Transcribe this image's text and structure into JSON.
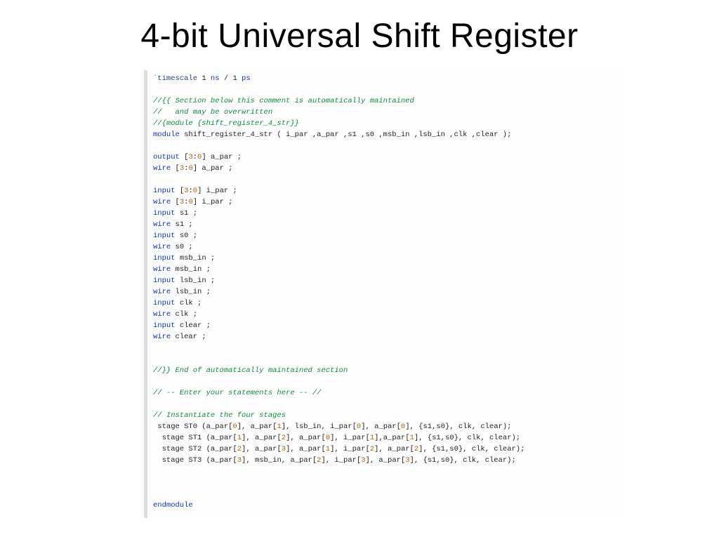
{
  "title": "4-bit Universal Shift Register",
  "code": {
    "timescale": {
      "kw": "`timescale",
      "val": " 1 ",
      "unit1": "ns",
      "slash": " / ",
      "one2": "1 ",
      "unit2": "ps"
    },
    "c1": "//{{ Section below this comment is automatically maintained",
    "c2": "//   and may be overwritten",
    "c3": "//{module {shift_register_4_str}}",
    "mod": {
      "kw": "module",
      "name": " shift_register_4_str ( i_par ,a_par ,s1 ,s0 ,msb_in ,lsb_in ,clk ,clear );"
    },
    "d01": {
      "kw": "output",
      "rng1": " [",
      "n1": "3",
      "colon": ":",
      "n2": "0",
      "rng2": "] ",
      "sig": "a_par ;"
    },
    "d02": {
      "kw": "wire",
      "rng1": " [",
      "n1": "3",
      "colon": ":",
      "n2": "0",
      "rng2": "] ",
      "sig": "a_par ;"
    },
    "d03": {
      "kw": "input",
      "rng1": " [",
      "n1": "3",
      "colon": ":",
      "n2": "0",
      "rng2": "] ",
      "sig": "i_par ;"
    },
    "d04": {
      "kw": "wire",
      "rng1": " [",
      "n1": "3",
      "colon": ":",
      "n2": "0",
      "rng2": "] ",
      "sig": "i_par ;"
    },
    "d05": {
      "kw": "input",
      "sig": " s1 ;"
    },
    "d06": {
      "kw": "wire",
      "sig": " s1 ;"
    },
    "d07": {
      "kw": "input",
      "sig": " s0 ;"
    },
    "d08": {
      "kw": "wire",
      "sig": " s0 ;"
    },
    "d09": {
      "kw": "input",
      "sig": " msb_in ;"
    },
    "d10": {
      "kw": "wire",
      "sig": " msb_in ;"
    },
    "d11": {
      "kw": "input",
      "sig": " lsb_in ;"
    },
    "d12": {
      "kw": "wire",
      "sig": " lsb_in ;"
    },
    "d13": {
      "kw": "input",
      "sig": " clk ;"
    },
    "d14": {
      "kw": "wire",
      "sig": " clk ;"
    },
    "d15": {
      "kw": "input",
      "sig": " clear ;"
    },
    "d16": {
      "kw": "wire",
      "sig": " clear ;"
    },
    "c4": "//}} End of automatically maintained section",
    "c5": "// -- Enter your statements here -- //",
    "c6": "// Instantiate the four stages",
    "s0a": " stage ST0 (a_par[",
    "s0n1": "0",
    "s0b": "], a_par[",
    "s0n2": "1",
    "s0c": "], lsb_in, i_par[",
    "s0n3": "0",
    "s0d": "], a_par[",
    "s0n4": "0",
    "s0e": "], {s1,s0}, clk, clear);",
    "s1a": "  stage ST1 (a_par[",
    "s1n1": "1",
    "s1b": "], a_par[",
    "s1n2": "2",
    "s1c": "], a_par[",
    "s1n3": "0",
    "s1d": "], i_par[",
    "s1n4": "1",
    "s1e": "],a_par[",
    "s1n5": "1",
    "s1f": "], {s1,s0}, clk, clear);",
    "s2a": "  stage ST2 (a_par[",
    "s2n1": "2",
    "s2b": "], a_par[",
    "s2n2": "3",
    "s2c": "], a_par[",
    "s2n3": "1",
    "s2d": "], i_par[",
    "s2n4": "2",
    "s2e": "], a_par[",
    "s2n5": "2",
    "s2f": "], {s1,s0}, clk, clear);",
    "s3a": "  stage ST3 (a_par[",
    "s3n1": "3",
    "s3b": "], msb_in, a_par[",
    "s3n2": "2",
    "s3c": "], i_par[",
    "s3n3": "3",
    "s3d": "], a_par[",
    "s3n4": "3",
    "s3e": "], {s1,s0}, clk, clear);",
    "endmod": "endmodule"
  }
}
